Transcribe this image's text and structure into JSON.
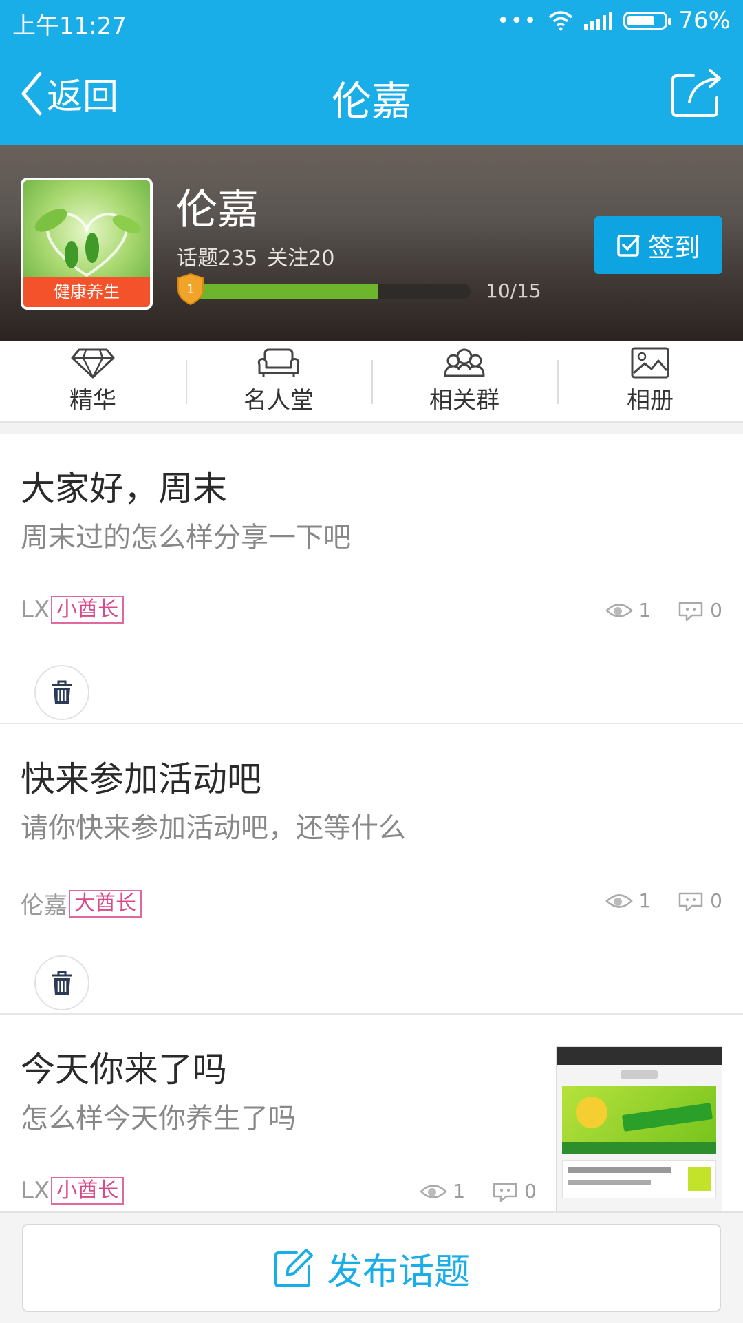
{
  "status_bar": {
    "time": "上午11:27",
    "battery_text": "76%",
    "battery_level": 0.76
  },
  "header": {
    "back_label": "返回",
    "title": "伦嘉"
  },
  "group": {
    "name": "伦嘉",
    "category_badge": "健康养生",
    "topics": "话题235",
    "follows": "关注20",
    "level": "1",
    "level_progress_text": "10/15",
    "level_progress": 0.667,
    "signin_label": "签到"
  },
  "tabs": [
    {
      "label": "精华",
      "icon": "diamond-icon"
    },
    {
      "label": "名人堂",
      "icon": "sofa-icon"
    },
    {
      "label": "相关群",
      "icon": "group-icon"
    },
    {
      "label": "相册",
      "icon": "album-icon"
    }
  ],
  "posts": [
    {
      "title": "大家好，周末",
      "summary": "周末过的怎么样分享一下吧",
      "author": "LX",
      "role": "小酋长",
      "views": "1",
      "comments": "0"
    },
    {
      "title": "快来参加活动吧",
      "summary": "请你快来参加活动吧，还等什么",
      "author": "伦嘉",
      "role": "大酋长",
      "views": "1",
      "comments": "0"
    },
    {
      "title": "今天你来了吗",
      "summary": "怎么样今天你养生了吗",
      "author": "LX",
      "role": "小酋长",
      "views": "1",
      "comments": "0"
    }
  ],
  "publish_label": "发布话题",
  "colors": {
    "primary": "#1aaee8",
    "progress": "#6db52c",
    "badge": "#f4522b",
    "role": "#d94a8a"
  }
}
